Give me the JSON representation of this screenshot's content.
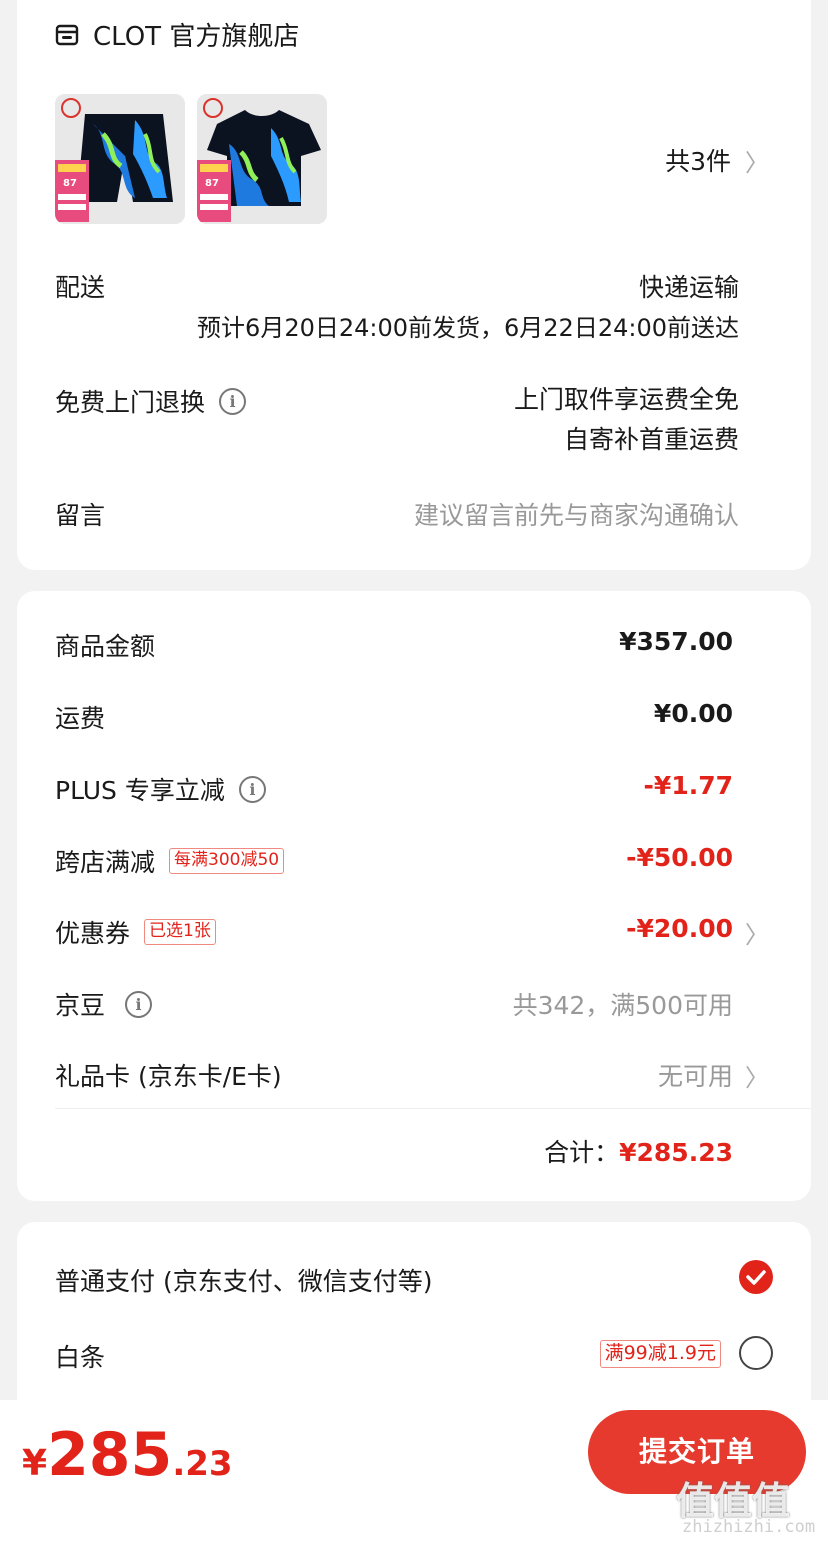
{
  "store": {
    "name": "CLOT 官方旗舰店",
    "item_count": "共3件",
    "product_thumbs": [
      {
        "icon": "shorts-product-icon",
        "badge": "87"
      },
      {
        "icon": "tshirt-product-icon",
        "badge": "87"
      }
    ]
  },
  "delivery": {
    "label": "配送",
    "method": "快递运输",
    "eta": "预计6月20日24:00前发货，6月22日24:00前送达"
  },
  "returns": {
    "label": "免费上门退换",
    "line1": "上门取件享运费全免",
    "line2": "自寄补首重运费"
  },
  "message": {
    "label": "留言",
    "placeholder": "建议留言前先与商家沟通确认"
  },
  "amounts": {
    "goods_label": "商品金额",
    "goods_value": "¥357.00",
    "shipping_label": "运费",
    "shipping_value": "¥0.00",
    "plus_label": "PLUS 专享立减",
    "plus_value": "-¥1.77",
    "cross_label": "跨店满减",
    "cross_tag": "每满300减50",
    "cross_value": "-¥50.00",
    "coupon_label": "优惠券",
    "coupon_tag": "已选1张",
    "coupon_value": "-¥20.00",
    "jingdou_label": "京豆",
    "jingdou_value": "共342，满500可用",
    "giftcard_label": "礼品卡 (京东卡/E卡)",
    "giftcard_value": "无可用",
    "total_label": "合计：",
    "total_value": "¥285.23"
  },
  "payment": {
    "normal_label": "普通支付 (京东支付、微信支付等)",
    "baitiao_label": "白条",
    "baitiao_tag": "满99减1.9元"
  },
  "footer": {
    "currency": "¥",
    "price_int": "285",
    "price_dec": ".23",
    "submit_label": "提交订单"
  },
  "watermark": {
    "logo": "值值值",
    "url": "zhizhizhi.com"
  },
  "colors": {
    "accent_red": "#e2231a",
    "button_red": "#e63a2e",
    "background": "#f2f2f2"
  }
}
